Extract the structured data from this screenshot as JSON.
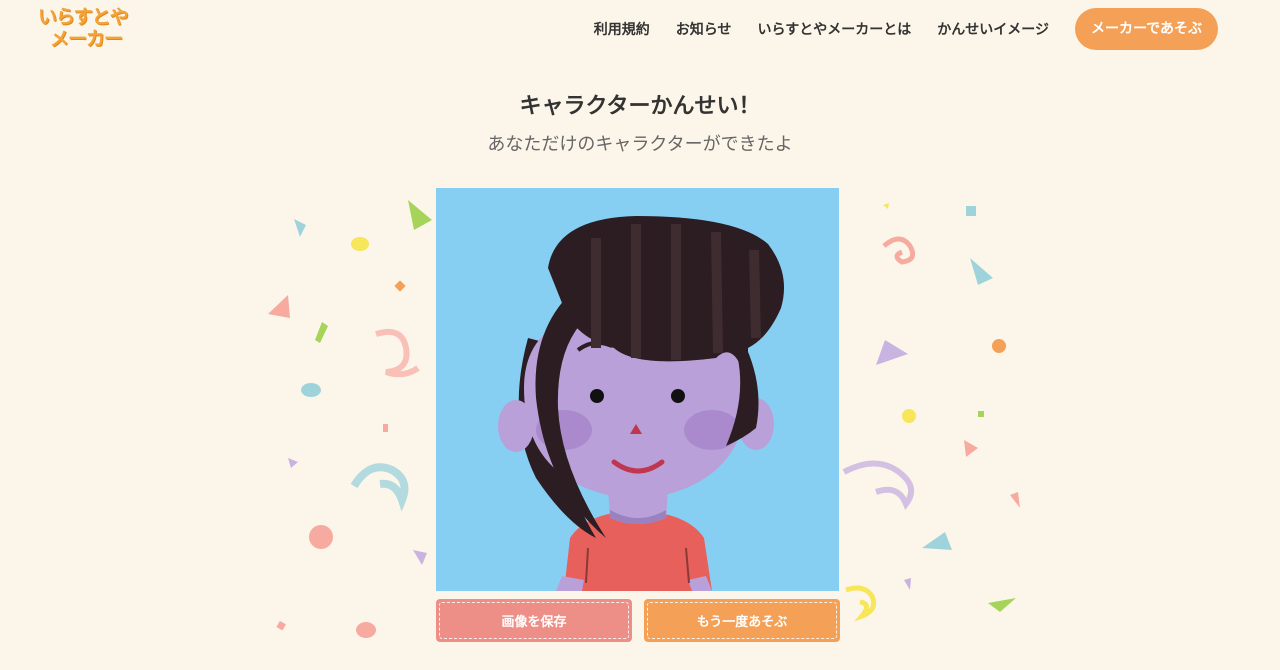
{
  "header": {
    "logo_line1": "いらすとや",
    "logo_line2": "メーカー",
    "nav": [
      "利用規約",
      "お知らせ",
      "いらすとやメーカーとは",
      "かんせいイメージ"
    ],
    "cta_label": "メーカーであそぶ"
  },
  "main": {
    "title": "キャラクターかんせい！",
    "subtitle": "あなただけのキャラクターができたよ",
    "save_label": "画像を保存",
    "play_again_label": "もう一度あそぶ"
  },
  "colors": {
    "background": "#fcf6ea",
    "accent_orange": "#f4a057",
    "save_button": "#ee8f87",
    "character_bg": "#87cff2",
    "logo": "#f2a33a"
  }
}
